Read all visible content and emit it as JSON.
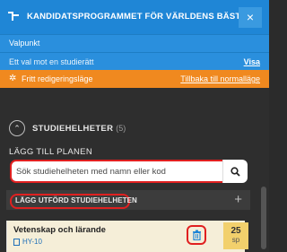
{
  "header": {
    "title": "KANDIDATSPROGRAMMET FÖR VÄRLDENS BÄSTA",
    "close_label": "×"
  },
  "info": {
    "valpunkt": "Valpunkt",
    "studyright_text": "Ett val mot en studierätt",
    "visa": "Visa"
  },
  "edit_mode": {
    "text": "Fritt redigeringsläge",
    "back_link": "Tillbaka till normalläge"
  },
  "section": {
    "title": "STUDIEHELHETER",
    "count": "(5)"
  },
  "add_to_plan": {
    "label": "LÄGG TILL PLANEN",
    "search_placeholder": "Sök studiehelheten med namn eller kod"
  },
  "completed": {
    "label": "LÄGG UTFÖRD STUDIEHELHETEN",
    "plus": "+"
  },
  "course": {
    "name": "Vetenskap och lärande",
    "code": "HY-10",
    "credits": "25",
    "credits_unit": "sp"
  },
  "colors": {
    "header_blue": "#1f86d6",
    "edit_orange": "#f0891f",
    "highlight_red": "#e02020",
    "credits_yellow": "#f2d06c"
  }
}
